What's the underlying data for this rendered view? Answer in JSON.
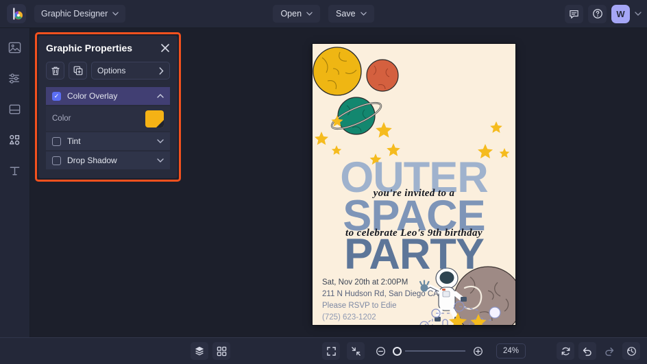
{
  "app": {
    "logo_icon": "palette-logo-icon",
    "project_name": "Graphic Designer",
    "open_label": "Open",
    "save_label": "Save",
    "feedback_icon": "comment-icon",
    "help_icon": "help-circle-icon",
    "avatar_initial": "W",
    "avatar_color": "#a5a6f6"
  },
  "rail": {
    "items": [
      {
        "name": "image-tool",
        "icon": "image-icon"
      },
      {
        "name": "adjust-tool",
        "icon": "sliders-icon"
      },
      {
        "name": "layout-tool",
        "icon": "frame-icon"
      },
      {
        "name": "shapes-tool",
        "icon": "shapes-icon"
      },
      {
        "name": "text-tool",
        "icon": "text-icon"
      }
    ]
  },
  "panel": {
    "title": "Graphic Properties",
    "close_icon": "close-icon",
    "highlight_color": "#f4511e",
    "tools": {
      "delete_icon": "trash-icon",
      "duplicate_icon": "duplicate-icon",
      "options_label": "Options",
      "options_chevron": "chevron-right-icon"
    },
    "sections": [
      {
        "label": "Color Overlay",
        "checked": true,
        "expanded": true,
        "chevron": "chevron-up-icon",
        "color_label": "Color",
        "color_value": "#f5b215"
      },
      {
        "label": "Tint",
        "checked": false,
        "expanded": false,
        "chevron": "chevron-down-icon"
      },
      {
        "label": "Drop Shadow",
        "checked": false,
        "expanded": false,
        "chevron": "chevron-down-icon"
      }
    ]
  },
  "canvas": {
    "background": "#fbefdd",
    "headline": [
      {
        "text": "OUTER",
        "color": "#9fb2cd"
      },
      {
        "text": "SPACE",
        "color": "#7e95b8"
      },
      {
        "text": "PARTY",
        "color": "#5d7699"
      }
    ],
    "script_line_1": "you're invited to a",
    "script_line_2": "to celebrate Leo's 9th birthday",
    "details": [
      {
        "text": "Sat, Nov 20th at 2:00PM",
        "color": "#3c4554"
      },
      {
        "text": "211 N Hudson Rd, San Diego CA",
        "color": "#56607a"
      },
      {
        "text": "Please RSVP to Edie",
        "color": "#7d88a3"
      },
      {
        "text": "(725) 623-1202",
        "color": "#8e99b3"
      }
    ],
    "art": {
      "planet_yellow": "#efb613",
      "planet_orange": "#d4603f",
      "planet_green": "#13876f",
      "moon": "#9e8a85",
      "star_color": "#f5bb1e"
    }
  },
  "bottombar": {
    "layers_icon": "layers-icon",
    "grid_icon": "grid-icon",
    "fit_icon": "fit-screen-icon",
    "collapse_icon": "collapse-icon",
    "zoom_out_icon": "zoom-out-icon",
    "zoom_in_icon": "zoom-in-icon",
    "zoom_value": "24%",
    "reset_icon": "reset-icon",
    "undo_icon": "undo-icon",
    "redo_icon": "redo-icon",
    "history_icon": "history-icon"
  }
}
